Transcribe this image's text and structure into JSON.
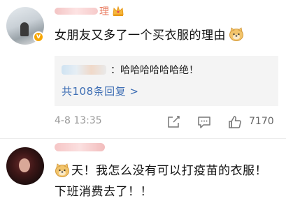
{
  "comment1": {
    "username_visible": "理",
    "text": "女朋友又多了一个买衣服的理由",
    "reply_preview": {
      "text": "：哈哈哈哈哈哈绝！",
      "more_label": "共108条回复 >"
    },
    "timestamp": "4-8 13:35",
    "likes": "7170",
    "icons": [
      "crown-icon",
      "verified-badge-icon",
      "doge-emoji",
      "share-icon",
      "comment-icon",
      "like-icon"
    ]
  },
  "comment2": {
    "text": "天！我怎么没有可以打疫苗的衣服！下班消费去了！！",
    "icons": [
      "doge-emoji"
    ]
  },
  "colors": {
    "link": "#3e6eb4",
    "username": "#e8765a",
    "meta": "#999999",
    "reply_bg": "#f4f4f4",
    "verified": "#f7a600"
  }
}
